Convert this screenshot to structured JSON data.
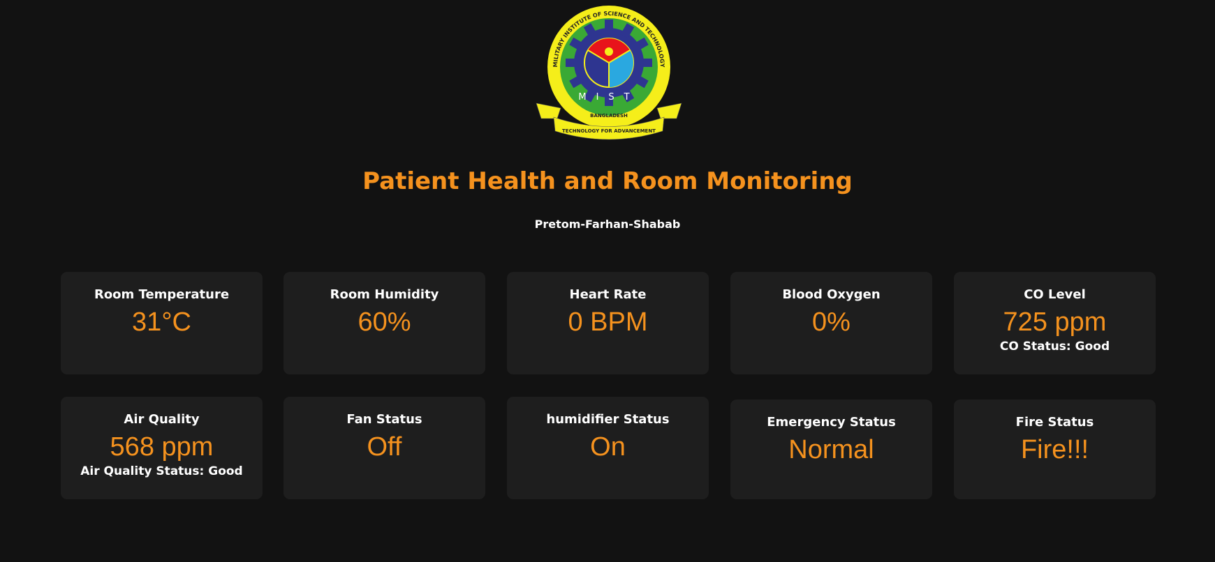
{
  "header": {
    "logo_text": {
      "ring": "MILITARY INSTITUTE OF SCIENCE AND TECHNOLOGY",
      "letters": "M I S T",
      "country": "BANGLADESH",
      "motto": "TECHNOLOGY FOR ADVANCEMENT"
    },
    "title": "Patient Health and Room Monitoring",
    "subtitle": "Pretom-Farhan-Shabab"
  },
  "colors": {
    "accent": "#f5921e",
    "background": "#121212",
    "card": "#1e1e1e"
  },
  "cards": [
    {
      "title": "Room Temperature",
      "value": "31°C"
    },
    {
      "title": "Room Humidity",
      "value": "60%"
    },
    {
      "title": "Heart Rate",
      "value": "0 BPM"
    },
    {
      "title": "Blood Oxygen",
      "value": "0%"
    },
    {
      "title": "CO Level",
      "value": "725 ppm",
      "status": "CO Status: Good"
    },
    {
      "title": "Air Quality",
      "value": "568 ppm",
      "status": "Air Quality Status: Good"
    },
    {
      "title": "Fan Status",
      "value": "Off"
    },
    {
      "title": "humidifier Status",
      "value": "On"
    },
    {
      "title": "Emergency Status",
      "value": "Normal"
    },
    {
      "title": "Fire Status",
      "value": "Fire!!!"
    }
  ]
}
